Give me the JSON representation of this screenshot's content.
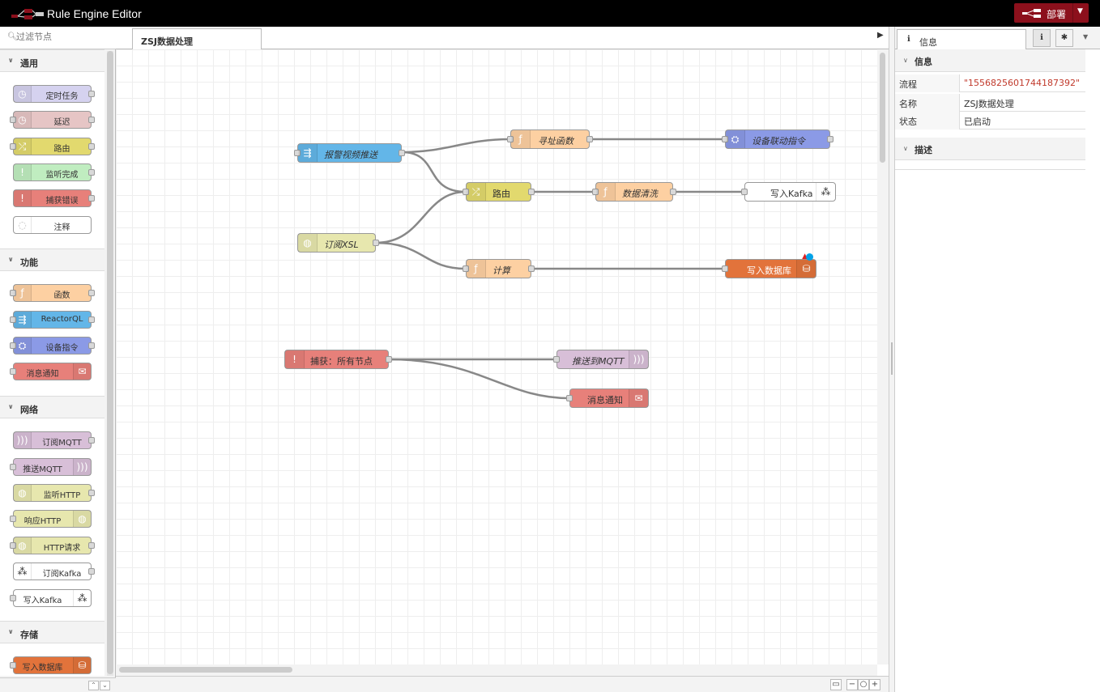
{
  "app": {
    "title": "Rule Engine Editor"
  },
  "deploy": {
    "label": "部署"
  },
  "palette": {
    "filter_placeholder": "过滤节点",
    "categories": [
      {
        "name": "通用",
        "nodes": [
          "定时任务",
          "延迟",
          "路由",
          "监听完成",
          "捕获错误",
          "注释"
        ]
      },
      {
        "name": "功能",
        "nodes": [
          "函数",
          "ReactorQL",
          "设备指令",
          "消息通知"
        ]
      },
      {
        "name": "网络",
        "nodes": [
          "订阅MQTT",
          "推送MQTT",
          "监听HTTP",
          "响应HTTP",
          "HTTP请求",
          "订阅Kafka",
          "写入Kafka"
        ]
      },
      {
        "name": "存储",
        "nodes": [
          "写入数据库"
        ]
      }
    ]
  },
  "workspace": {
    "tab": "ZSJ数据处理"
  },
  "flow": {
    "nodes": {
      "alarm_video_push": "报警视频推送",
      "address_func": "寻址函数",
      "device_linkage": "设备联动指令",
      "route": "路由",
      "data_clean": "数据清洗",
      "write_kafka": "写入Kafka",
      "subscribe_xsl": "订阅XSL",
      "calc": "计算",
      "write_db": "写入数据库",
      "catch_all": "捕获：所有节点",
      "push_mqtt": "推送到MQTT",
      "msg_notify": "消息通知"
    }
  },
  "sidebar": {
    "tab": "信息",
    "section_info": "信息",
    "rows": [
      {
        "key": "流程",
        "value": "\"1556825601744187392\""
      },
      {
        "key": "名称",
        "value": "ZSJ数据处理"
      },
      {
        "key": "状态",
        "value": "已启动"
      }
    ],
    "section_desc": "描述"
  },
  "colors": {
    "inject": "#d5d2ef",
    "delay": "#e6c5c5",
    "switch": "#e2d96e",
    "complete": "#c0edc0",
    "catch": "#e7807a",
    "function": "#fdd0a2",
    "reactorql": "#63b6e8",
    "device": "#8b9ae6",
    "mqtt": "#d8bfd8",
    "http": "#e7e7ae",
    "database": "#e2733b",
    "header_bg": "#000000",
    "deploy_bg": "#8c101c",
    "flow_id_color": "#c0392b"
  }
}
